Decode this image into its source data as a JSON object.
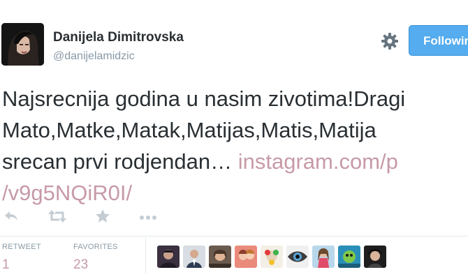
{
  "user": {
    "name": "Danijela Dimitrovska",
    "handle": "@danijelamidzic"
  },
  "header": {
    "follow_label": "Following"
  },
  "tweet": {
    "line1": "Najsrecnija godina u nasim zivotima!Dragi",
    "line2": "Mato,Matke,Matak,Matijas,Matis,Matija",
    "line3_text": "srecan prvi rodjendan… ",
    "link_part1": "instagram.com/p",
    "link_part2": "/v9g5NQiR0I/"
  },
  "stats": {
    "retweet_label": "RETWEET",
    "retweet_count": "1",
    "favorites_label": "FAVORITES",
    "favorites_count": "23"
  },
  "icons": {
    "reply": "reply-icon",
    "retweet": "retweet-icon",
    "favorite": "star-icon",
    "more": "more-icon",
    "settings": "gear-icon"
  },
  "colors": {
    "follow_button": "#55acee",
    "link": "#c79aa7",
    "muted": "#8899a6",
    "text": "#292f33"
  }
}
